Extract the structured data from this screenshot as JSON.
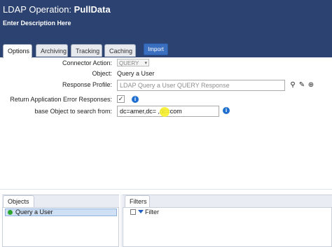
{
  "header": {
    "title_prefix": "LDAP Operation:",
    "title_name": "PullData",
    "description": "Enter Description Here"
  },
  "tabs": [
    {
      "label": "Options",
      "active": true
    },
    {
      "label": "Archiving",
      "active": false
    },
    {
      "label": "Tracking",
      "active": false
    },
    {
      "label": "Caching",
      "active": false
    }
  ],
  "import_button": "Import",
  "form": {
    "connector_action_label": "Connector Action:",
    "connector_action_value": "QUERY",
    "object_label": "Object:",
    "object_value": "Query a User",
    "response_profile_label": "Response Profile:",
    "response_profile_placeholder": "LDAP Query a User QUERY Response",
    "return_errors_label": "Return Application Error Responses:",
    "return_errors_checked": true,
    "base_object_label": "base Object to search from:",
    "base_object_value": "dc=amer,dc=   ,dc=com"
  },
  "bottom": {
    "objects_tab": "Objects",
    "objects_items": [
      "Query a User"
    ],
    "filters_tab": "Filters",
    "filter_label": "Filter"
  },
  "colors": {
    "header_bg": "#2c4270",
    "accent": "#3a6fc0",
    "info_icon": "#1f6fd0",
    "selected_item": "#cfe0f4",
    "status_dot": "#2da62d"
  }
}
